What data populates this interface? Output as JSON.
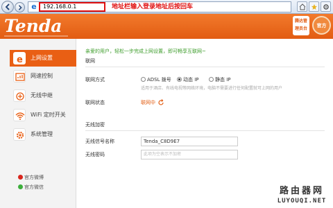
{
  "browser": {
    "address": "192.168.0.1",
    "address_hint": "地址栏输入登录地址后按回车"
  },
  "header": {
    "logo": "Tenda",
    "badge_line1": "腾达管",
    "badge_line2": "理员台",
    "circle_text": "官方"
  },
  "sidebar": {
    "items": [
      {
        "label": "上网设置",
        "icon": "e-icon",
        "active": true
      },
      {
        "label": "网速控制",
        "icon": "speed-icon",
        "active": false
      },
      {
        "label": "无线中继",
        "icon": "repeater-icon",
        "active": false
      },
      {
        "label": "WiFi 定时开关",
        "icon": "wifi-icon",
        "active": false
      },
      {
        "label": "系统管理",
        "icon": "gear-icon",
        "active": false
      }
    ],
    "footer": [
      {
        "label": "官方微博",
        "icon": "weibo-icon"
      },
      {
        "label": "官方微信",
        "icon": "wechat-icon"
      }
    ]
  },
  "content": {
    "welcome": "亲爱的用户，轻松一步完成上网设置，即可畅享互联网~",
    "section_network": "联网",
    "mode_label": "联网方式",
    "modes": [
      {
        "label": "ADSL 拨号",
        "selected": false
      },
      {
        "label": "动态 IP",
        "selected": true
      },
      {
        "label": "静态 IP",
        "selected": false
      }
    ],
    "mode_hint": "适用于酒店、有线电视等网络环境，电脑不需要进行任何配置就可上网的用户",
    "status_label": "联网状态",
    "status_value": "联网中",
    "section_wireless": "无线加密",
    "ssid_label": "无线信号名称",
    "ssid_value": "Tenda_C8D9E7",
    "password_label": "无线密码",
    "password_placeholder": "此项为空表示不加密"
  },
  "watermark": {
    "cn": "路由器网",
    "en": "LUYOUQI.NET"
  },
  "colors": {
    "brand_orange": "#e95f14",
    "welcome_green": "#3c9c2a",
    "hint_red": "#e01010"
  }
}
